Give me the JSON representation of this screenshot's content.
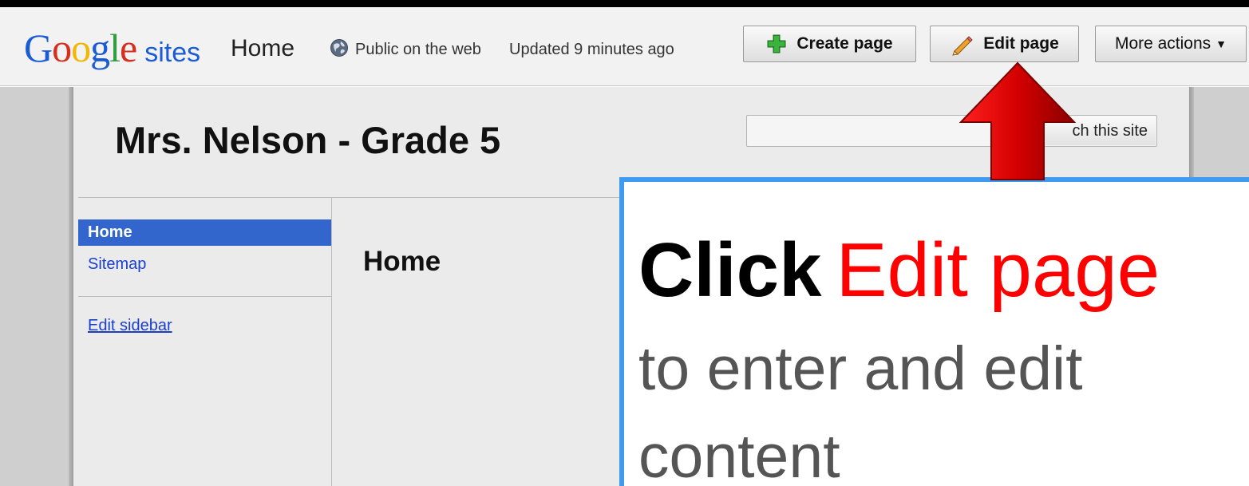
{
  "topbar": {
    "logo_letters": [
      {
        "ch": "G",
        "color": "#1a5bd6"
      },
      {
        "ch": "o",
        "color": "#d62f1f"
      },
      {
        "ch": "o",
        "color": "#f2b705"
      },
      {
        "ch": "g",
        "color": "#1a5bd6"
      },
      {
        "ch": "l",
        "color": "#2f9e3e"
      },
      {
        "ch": "e",
        "color": "#d62f1f"
      }
    ],
    "logo_product": "sites",
    "page_name": "Home",
    "visibility": "Public on the web",
    "updated": "Updated 9 minutes ago",
    "buttons": {
      "create": "Create page",
      "edit": "Edit page",
      "more": "More actions"
    }
  },
  "site": {
    "title": "Mrs. Nelson - Grade 5",
    "search_button": "ch this site",
    "search_value": ""
  },
  "sidebar": {
    "items": [
      {
        "label": "Home",
        "selected": true
      },
      {
        "label": "Sitemap",
        "selected": false
      }
    ],
    "edit_link": "Edit sidebar"
  },
  "main": {
    "heading": "Home"
  },
  "callout": {
    "click": "Click",
    "target": "Edit page",
    "line2": "to enter and edit",
    "line3": "content"
  },
  "colors": {
    "nav_selected": "#3366cc",
    "callout_border": "#3f9bef",
    "arrow_red": "#cc0000",
    "link_blue": "#1a3fcc"
  }
}
